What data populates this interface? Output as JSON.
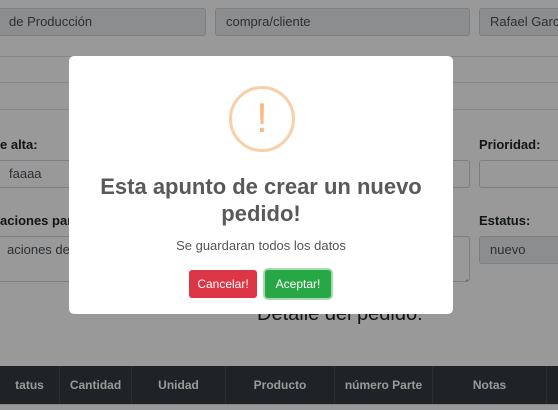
{
  "form": {
    "field_production": "de Producción",
    "field_purchase": "compra/cliente",
    "field_person": "Rafael Garcia",
    "label_alta": "e alta:",
    "field_alta": "faaaa",
    "label_priority": "Prioridad:",
    "label_observations": "aciones partic",
    "textarea_observations": "aciones del p",
    "label_status": "Estatus:",
    "field_status": "nuevo",
    "section_title": "Detalle del pedido:"
  },
  "table": {
    "headers": [
      "tatus",
      "Cantidad",
      "Unidad",
      "Producto",
      "número Parte",
      "Notas",
      ""
    ]
  },
  "modal": {
    "icon": "!",
    "title": "Esta apunto de crear un nuevo pedido!",
    "text": "Se guardaran todos los datos",
    "cancel_label": "Cancelar!",
    "ok_label": "Aceptar!"
  },
  "colors": {
    "cancel": "#dc3545",
    "ok": "#28a745",
    "warning": "#f8bb86",
    "table_header": "#343a40"
  }
}
